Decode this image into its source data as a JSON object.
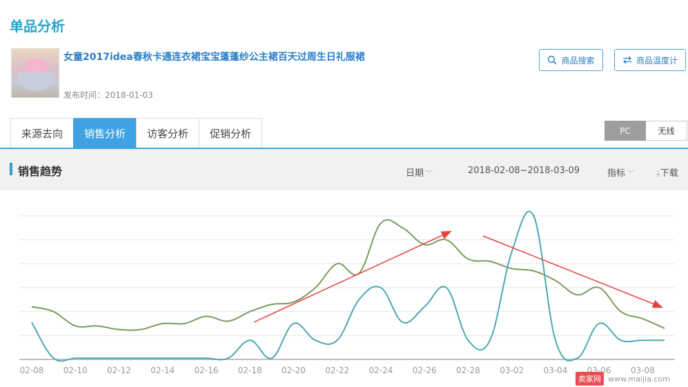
{
  "page": {
    "title": "单品分析"
  },
  "product": {
    "name": "女童2017idea春秋卡通连衣裙宝宝蓬蓬纱公主裙百天过周生日礼服裙",
    "publish_date": "发布时间：2018-01-03"
  },
  "actions": {
    "search_label": "商品搜索",
    "temp_label": "商品温度计"
  },
  "tabs": [
    {
      "label": "来源去向"
    },
    {
      "label": "销售分析",
      "active": true
    },
    {
      "label": "访客分析"
    },
    {
      "label": "促销分析"
    }
  ],
  "toggle": {
    "pc": "PC",
    "wireless": "无线",
    "selected": "PC"
  },
  "panel": {
    "title": "销售趋势",
    "date_label": "日期",
    "date_range": "2018-02-08~2018-03-09",
    "metric_label": "指标",
    "download_label": "下载"
  },
  "watermark": {
    "logo": "卖家网",
    "url": "www.maijia.com"
  },
  "colors": {
    "accent": "#3ea3e2",
    "title": "#26a5c8",
    "series_green": "#7a9a5e",
    "series_teal": "#4aa8b0",
    "arrow_red": "#e8403c"
  },
  "chart_data": {
    "type": "line",
    "x": [
      "02-08",
      "02-09",
      "02-10",
      "02-11",
      "02-12",
      "02-13",
      "02-14",
      "02-15",
      "02-16",
      "02-17",
      "02-18",
      "02-19",
      "02-20",
      "02-21",
      "02-22",
      "02-23",
      "02-24",
      "02-25",
      "02-26",
      "02-27",
      "02-28",
      "03-01",
      "03-02",
      "03-03",
      "03-04",
      "03-05",
      "03-06",
      "03-07",
      "03-08",
      "03-09"
    ],
    "tick_labels": [
      "02-08",
      "02-10",
      "02-12",
      "02-14",
      "02-16",
      "02-18",
      "02-20",
      "02-22",
      "02-24",
      "02-26",
      "02-28",
      "03-02",
      "03-04",
      "03-06",
      "03-08"
    ],
    "ylim": [
      0,
      6
    ],
    "grid": true,
    "series": [
      {
        "color": "#7a9a5e",
        "values": [
          2.2,
          2.0,
          1.4,
          1.4,
          1.25,
          1.25,
          1.5,
          1.5,
          1.8,
          1.6,
          2.0,
          2.3,
          2.4,
          3.0,
          4.0,
          3.6,
          5.7,
          5.5,
          4.8,
          5.0,
          4.2,
          4.1,
          3.8,
          3.7,
          3.3,
          2.7,
          3.0,
          2.0,
          1.7,
          1.3
        ]
      },
      {
        "color": "#4aa8b0",
        "values": [
          1.55,
          0.05,
          0.05,
          0.05,
          0.05,
          0.05,
          0.05,
          0.05,
          0.05,
          0.05,
          0.8,
          0.05,
          1.5,
          0.8,
          0.8,
          2.5,
          3.0,
          1.55,
          2.2,
          3.0,
          0.8,
          0.8,
          4.5,
          6.0,
          0.8,
          0.05,
          1.5,
          0.8,
          0.8,
          0.8
        ]
      }
    ]
  }
}
